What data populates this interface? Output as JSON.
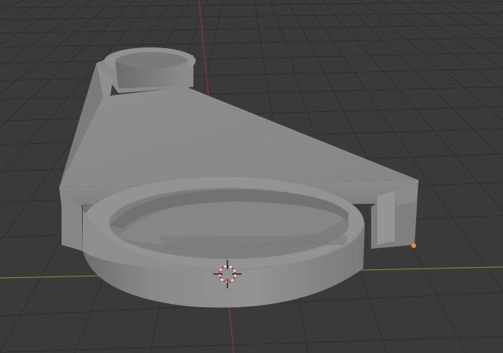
{
  "viewport": {
    "background": "#3a3a3a",
    "grid_color": "#2e2e2e",
    "x_axis_color": "#7a9a2e",
    "y_axis_color": "#9a3a3a",
    "mesh_color": "#8d8d8d",
    "selected_vertex_color": "#f08a1c"
  },
  "scene_objects": [
    {
      "name": "bracket-mesh",
      "type": "mesh"
    },
    {
      "name": "3d-cursor",
      "type": "cursor"
    }
  ]
}
